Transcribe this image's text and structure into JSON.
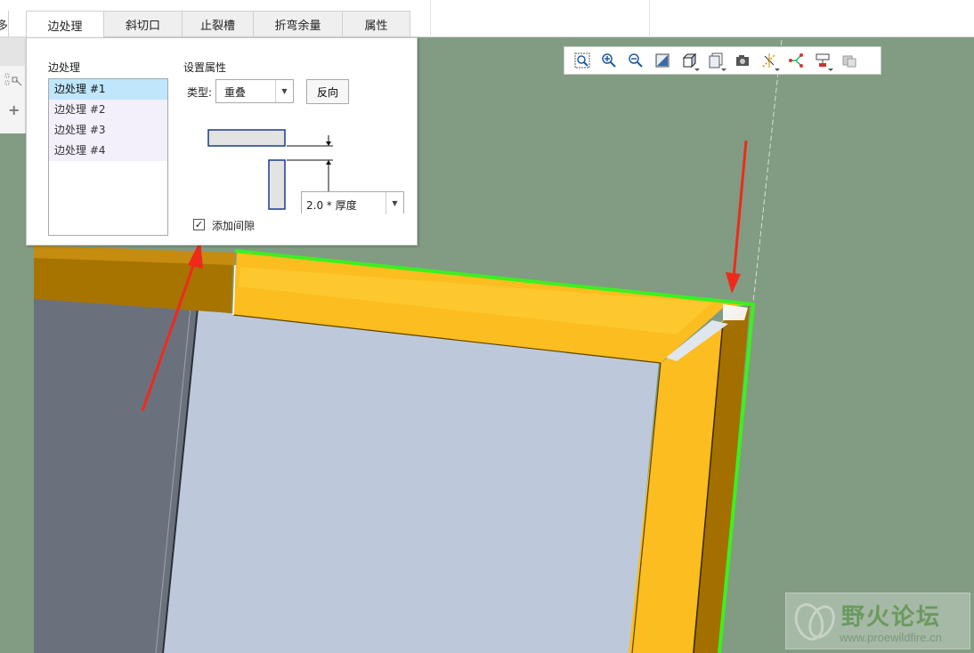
{
  "ribbon": {
    "tab_stub_label": "多",
    "tabs": [
      {
        "label": "边处理",
        "active": true
      },
      {
        "label": "斜切口",
        "active": false
      },
      {
        "label": "止裂槽",
        "active": false
      },
      {
        "label": "折弯余量",
        "active": false
      },
      {
        "label": "属性",
        "active": false
      }
    ]
  },
  "panel": {
    "list_title": "边处理",
    "items": [
      "边处理 #1",
      "边处理 #2",
      "边处理 #3",
      "边处理 #4"
    ],
    "selected_index": 0,
    "props_title": "设置属性",
    "type_label": "类型:",
    "type_value": "重叠",
    "reverse_button": "反向",
    "dimension_value": "2.0 * 厚度",
    "gap_checkbox_label": "添加间隙",
    "gap_checked": true,
    "checkbox_glyph": "✓"
  },
  "view_toolbar": {
    "icons": [
      "zoom-fit-icon",
      "zoom-in-icon",
      "zoom-out-icon",
      "repaint-icon",
      "display-style-icon",
      "saved-views-icon",
      "view-manager-icon",
      "datum-display-icon",
      "spin-center-icon",
      "annotation-display-icon",
      "appearance-icon"
    ]
  },
  "watermark": {
    "title": "野火论坛",
    "url": "www.proewildfire.cn"
  },
  "colors": {
    "background": "#819c82",
    "frame_orange": "#f9bc1e",
    "frame_dark": "#a87400",
    "panel_light": "#bcc9d9",
    "panel_dark": "#6c727e",
    "highlight_edge": "#3cf020",
    "arrow_red": "#ee2a1c",
    "list_selected": "#bfe6fb"
  }
}
